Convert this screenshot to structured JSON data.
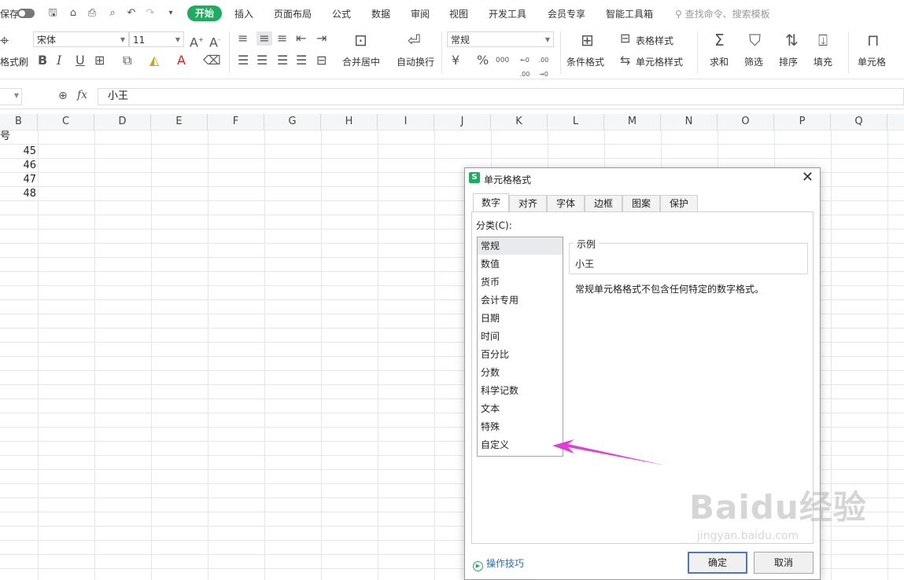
{
  "colors": {
    "accent": "#1aae5e",
    "arrow": "#e43cd9"
  },
  "quick": {
    "save_label": "保存"
  },
  "menu": {
    "tabs": [
      "开始",
      "插入",
      "页面布局",
      "公式",
      "数据",
      "审阅",
      "视图",
      "开发工具",
      "会员专享",
      "智能工具箱"
    ],
    "search_placeholder": "查找命令、搜索模板"
  },
  "ribbon": {
    "format_painter": "格式刷",
    "font_name": "宋体",
    "font_size": "11",
    "merge_center": "合并居中",
    "auto_wrap": "自动换行",
    "number_format": "常规",
    "cond_format": "条件格式",
    "table_style": "表格样式",
    "cell_style": "单元格样式",
    "sum": "求和",
    "filter": "筛选",
    "sort": "排序",
    "fill": "填充",
    "cell": "单元格",
    "bold": "B",
    "italic": "I",
    "underline": "U",
    "percent": "%",
    "thousands": "000",
    "dec_inc": "←0 .00",
    "dec_dec": ".00 →0"
  },
  "formula": {
    "fx_label": "fx",
    "value": "小王"
  },
  "grid": {
    "columns": [
      "B",
      "C",
      "D",
      "E",
      "F",
      "G",
      "H",
      "I",
      "J",
      "K",
      "L",
      "M",
      "N",
      "O",
      "P",
      "Q"
    ],
    "b_header_fragment": "号",
    "b_values": [
      "45",
      "46",
      "47",
      "48"
    ]
  },
  "dialog": {
    "title": "单元格格式",
    "logo": "S",
    "close": "✕",
    "tabs": [
      "数字",
      "对齐",
      "字体",
      "边框",
      "图案",
      "保护"
    ],
    "category_label": "分类(C):",
    "categories": [
      "常规",
      "数值",
      "货币",
      "会计专用",
      "日期",
      "时间",
      "百分比",
      "分数",
      "科学记数",
      "文本",
      "特殊",
      "自定义"
    ],
    "selected_category": "常规",
    "sample_title": "示例",
    "sample_value": "小王",
    "description": "常规单元格格式不包含任何特定的数字格式。",
    "tips": "操作技巧",
    "ok": "确定",
    "cancel": "取消"
  },
  "watermark": {
    "main": "Baidu经验",
    "sub": "jingyan.baidu.com"
  }
}
